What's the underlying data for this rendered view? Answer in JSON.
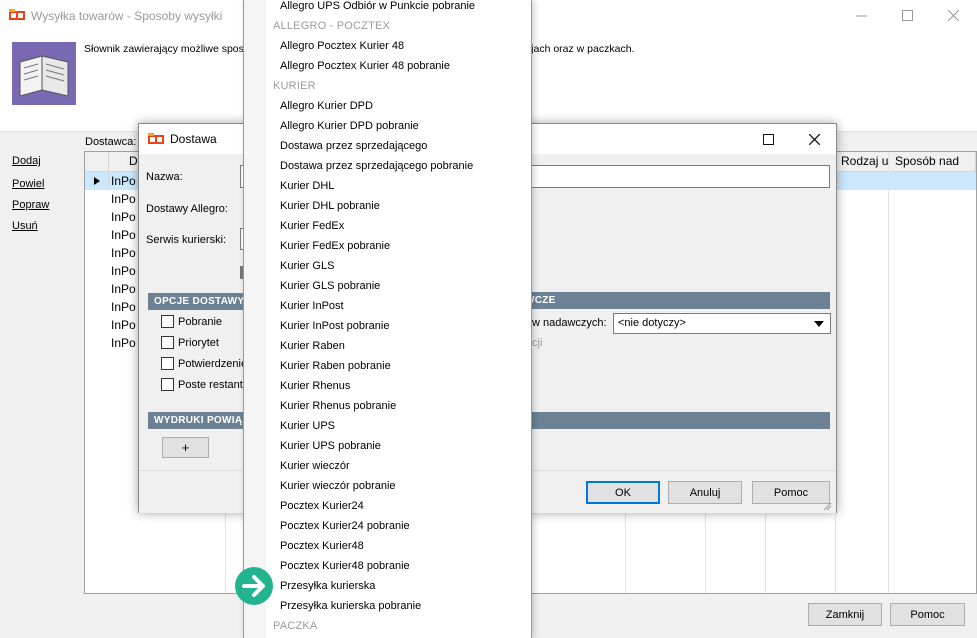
{
  "main": {
    "title": "Wysyłka towarów - Sposoby wysyłki",
    "description": "Słownik zawierający możliwe sposoby wysyłki towarów. Wartości wykorzystywane są w transakcjach oraz w paczkach.",
    "supplier_label": "Dostawca:",
    "side_actions": [
      "Dodaj",
      "Powiel",
      "Popraw",
      "Usuń"
    ],
    "grid": {
      "headers": [
        "D",
        "Rodzaj u",
        "Sposób nad"
      ],
      "rows": [
        "InPo",
        "InPo",
        "InPo",
        "InPo",
        "InPo",
        "InPo",
        "InPo",
        "InPo",
        "InPo",
        "InPo"
      ]
    },
    "buttons": {
      "close": "Zamknij",
      "help": "Pomoc"
    }
  },
  "dialog": {
    "title": "Dostawa",
    "labels": {
      "name": "Nazwa:",
      "allegro": "Dostawy Allegro:",
      "courier": "Serwis kurierski:"
    },
    "sections": {
      "options": "OPCJE DOSTAWY",
      "prints": "WYDRUKI POWIĄZ",
      "right": "WCZE"
    },
    "options": [
      "Pobranie",
      "Priorytet",
      "Potwierdzenie",
      "Poste restant"
    ],
    "add_button": "+",
    "sender_label": "w nadawczych:",
    "sender_value": "<nie dotyczy>",
    "sender_hint": "cji",
    "buttons": {
      "ok": "OK",
      "cancel": "Anuluj",
      "help": "Pomoc"
    }
  },
  "dropdown": {
    "entries": [
      {
        "kind": "item",
        "text": "Allegro UPS Odbiór w Punkcie pobranie"
      },
      {
        "kind": "group",
        "text": "ALLEGRO - POCZTEX"
      },
      {
        "kind": "item",
        "text": "Allegro Pocztex Kurier 48"
      },
      {
        "kind": "item",
        "text": "Allegro Pocztex Kurier 48 pobranie"
      },
      {
        "kind": "group",
        "text": "KURIER"
      },
      {
        "kind": "item",
        "text": "Allegro Kurier DPD"
      },
      {
        "kind": "item",
        "text": "Allegro Kurier DPD pobranie"
      },
      {
        "kind": "item",
        "text": "Dostawa przez sprzedającego"
      },
      {
        "kind": "item",
        "text": "Dostawa przez sprzedającego pobranie"
      },
      {
        "kind": "item",
        "text": "Kurier DHL"
      },
      {
        "kind": "item",
        "text": "Kurier DHL pobranie"
      },
      {
        "kind": "item",
        "text": "Kurier FedEx"
      },
      {
        "kind": "item",
        "text": "Kurier FedEx pobranie"
      },
      {
        "kind": "item",
        "text": "Kurier GLS"
      },
      {
        "kind": "item",
        "text": "Kurier GLS pobranie"
      },
      {
        "kind": "item",
        "text": "Kurier InPost"
      },
      {
        "kind": "item",
        "text": "Kurier InPost pobranie"
      },
      {
        "kind": "item",
        "text": "Kurier Raben"
      },
      {
        "kind": "item",
        "text": "Kurier Raben pobranie"
      },
      {
        "kind": "item",
        "text": "Kurier Rhenus"
      },
      {
        "kind": "item",
        "text": "Kurier Rhenus pobranie"
      },
      {
        "kind": "item",
        "text": "Kurier UPS"
      },
      {
        "kind": "item",
        "text": "Kurier UPS pobranie"
      },
      {
        "kind": "item",
        "text": "Kurier wieczór"
      },
      {
        "kind": "item",
        "text": "Kurier wieczór pobranie"
      },
      {
        "kind": "item",
        "text": "Pocztex Kurier24"
      },
      {
        "kind": "item",
        "text": "Pocztex Kurier24 pobranie"
      },
      {
        "kind": "item",
        "text": "Pocztex Kurier48"
      },
      {
        "kind": "item",
        "text": "Pocztex Kurier48 pobranie"
      },
      {
        "kind": "item",
        "text": "Przesyłka kurierska"
      },
      {
        "kind": "item",
        "text": "Przesyłka kurierska pobranie"
      },
      {
        "kind": "group",
        "text": "PACZKA"
      }
    ]
  },
  "colors": {
    "section_bar": "#6c8294",
    "selection": "#cce8ff",
    "pointer": "#22b38f"
  },
  "icons": {
    "app": "app-logo-icon",
    "book": "book-icon",
    "pointer": "arrow-pointer-icon"
  }
}
